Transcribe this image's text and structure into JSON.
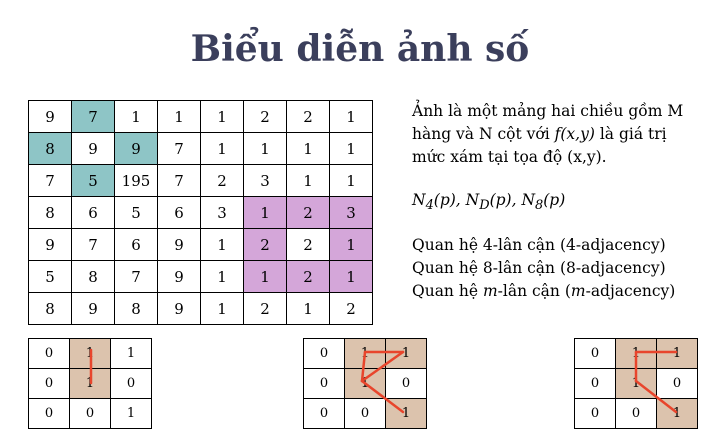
{
  "title": "Biểu diễn ảnh số",
  "image_grid": [
    [
      "9",
      "7",
      "1",
      "1",
      "1",
      "2",
      "2",
      "1"
    ],
    [
      "8",
      "9",
      "9",
      "7",
      "1",
      "1",
      "1",
      "1"
    ],
    [
      "7",
      "5",
      "195",
      "7",
      "2",
      "3",
      "1",
      "1"
    ],
    [
      "8",
      "6",
      "5",
      "6",
      "3",
      "1",
      "2",
      "3"
    ],
    [
      "9",
      "7",
      "6",
      "9",
      "1",
      "2",
      "2",
      "1"
    ],
    [
      "5",
      "8",
      "7",
      "9",
      "1",
      "1",
      "2",
      "1"
    ],
    [
      "8",
      "9",
      "8",
      "9",
      "1",
      "2",
      "1",
      "2"
    ]
  ],
  "description_lines": [
    "Ảnh là một mảng hai chiều gồm M",
    "hàng và N cột với ",
    "f(x,y)",
    " là giá trị",
    "mức xám tại tọa độ (x,y)."
  ],
  "notation": {
    "n4": "N",
    "n4_sub": "4",
    "n4_rest": "(p), ",
    "nd": "N",
    "nd_sub": "D",
    "nd_rest": "(p), ",
    "n8": "N",
    "n8_sub": "8",
    "n8_rest": "(p)"
  },
  "relations": {
    "r1": "Quan hệ 4-lân cận (4-adjacency)",
    "r2": "Quan hệ 8-lân cận (8-adjacency)",
    "r3_a": "Quan hệ ",
    "r3_m": "m",
    "r3_b": "-lân cận (",
    "r3_m2": "m",
    "r3_c": "-adjacency)"
  },
  "adjacency_grid": [
    [
      "0",
      "1",
      "1"
    ],
    [
      "0",
      "1",
      "0"
    ],
    [
      "0",
      "0",
      "1"
    ]
  ],
  "colors": {
    "teal": "#8ec5c6",
    "purple": "#d4a6d9",
    "tan": "#dcc3ad",
    "connector": "#e8452c",
    "title": "#3b3f5c"
  }
}
